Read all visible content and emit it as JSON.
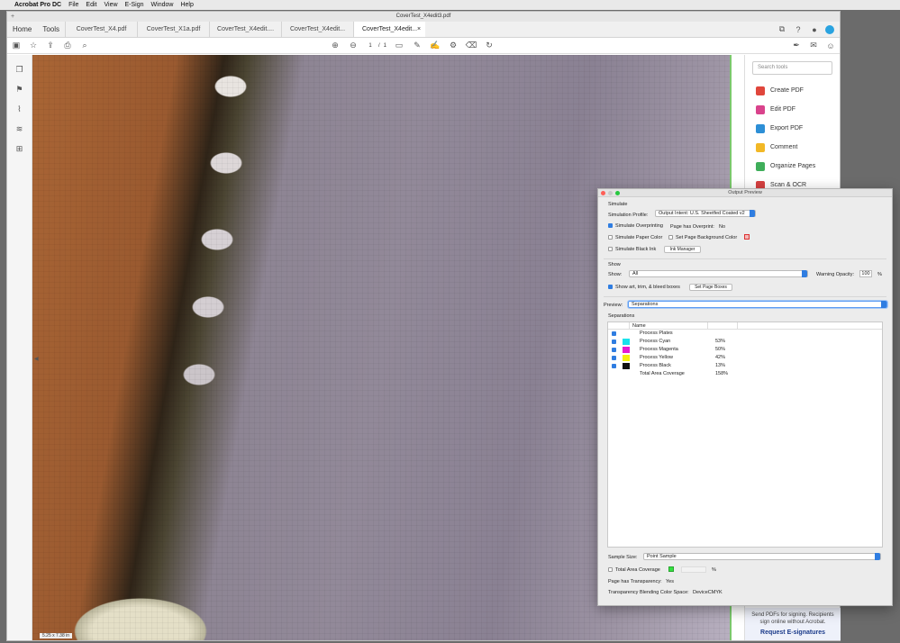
{
  "menubar": {
    "app": "Acrobat Pro DC",
    "items": [
      "File",
      "Edit",
      "View",
      "E-Sign",
      "Window",
      "Help"
    ]
  },
  "window": {
    "title": "CoverTest_X4edit3.pdf"
  },
  "tabs": {
    "home": "Home",
    "tools": "Tools",
    "docs": [
      "CoverTest_X4.pdf",
      "CoverTest_X1a.pdf",
      "CoverTest_X4edit....",
      "CoverTest_X4edit...",
      "CoverTest_X4edit..."
    ],
    "close": "×"
  },
  "toolbar": {
    "page_current": "1",
    "page_sep": "/",
    "page_total": "1"
  },
  "doc": {
    "status": "5.25 x 7.38 in"
  },
  "toolpane": {
    "search_placeholder": "Search tools",
    "items": [
      {
        "label": "Create PDF",
        "color": "#e0463c"
      },
      {
        "label": "Edit PDF",
        "color": "#d9438c"
      },
      {
        "label": "Export PDF",
        "color": "#2d8fd6"
      },
      {
        "label": "Comment",
        "color": "#f2b826"
      },
      {
        "label": "Organize Pages",
        "color": "#3fae5a"
      },
      {
        "label": "Scan & OCR",
        "color": "#d64040"
      }
    ],
    "promo_text_1": "Send PDFs for signing. Recipients",
    "promo_text_2": "sign online without Acrobat.",
    "promo_link": "Request E-signatures"
  },
  "dialog": {
    "title": "Output Preview",
    "simulate_header": "Simulate",
    "sim_profile_label": "Simulation Profile:",
    "sim_profile_value": "Output Intent: U.S. Sheetfed Coated v2",
    "simulate_overprinting": "Simulate Overprinting",
    "page_has_overprint_label": "Page has Overprint:",
    "page_has_overprint_value": "No",
    "simulate_paper_color": "Simulate Paper Color",
    "set_page_bg": "Set Page Background Color",
    "simulate_black_ink": "Simulate Black Ink",
    "ink_manager": "Ink Manager",
    "show_header": "Show",
    "show_label": "Show:",
    "show_value": "All",
    "warning_opacity_label": "Warning Opacity:",
    "warning_opacity_value": "100",
    "percent": "%",
    "show_boxes": "Show art, trim, & bleed boxes",
    "set_page_boxes": "Set Page Boxes",
    "preview_label": "Preview:",
    "preview_value": "Separations",
    "separations_header": "Separations",
    "col_name": "Name",
    "separations": [
      {
        "name": "Process Plates",
        "value": "",
        "swatch": ""
      },
      {
        "name": "Process Cyan",
        "value": "53%",
        "swatch": "#19e3ec"
      },
      {
        "name": "Process Magenta",
        "value": "50%",
        "swatch": "#e61bd2"
      },
      {
        "name": "Process Yellow",
        "value": "42%",
        "swatch": "#f4ef10"
      },
      {
        "name": "Process Black",
        "value": "13%",
        "swatch": "#111111"
      },
      {
        "name": "Total Area Coverage",
        "value": "158%",
        "swatch": ""
      }
    ],
    "sample_size_label": "Sample Size:",
    "sample_size_value": "Point Sample",
    "total_area_coverage": "Total Area Coverage",
    "page_has_transparency_label": "Page has Transparency:",
    "page_has_transparency_value": "Yes",
    "blending_label": "Transparency Blending Color Space:",
    "blending_value": "DeviceCMYK"
  }
}
